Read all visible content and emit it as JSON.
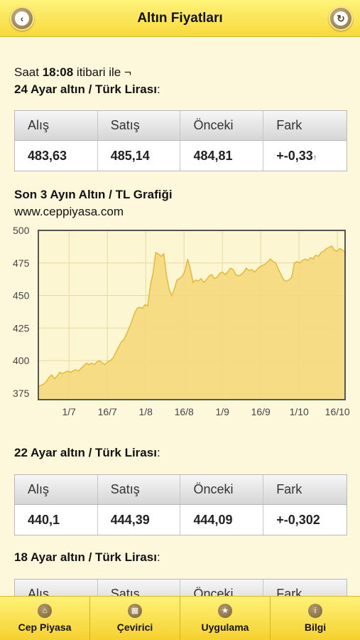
{
  "header": {
    "title": "Altın Fiyatları"
  },
  "intro": {
    "prefix": "Saat ",
    "time": "18:08",
    "suffix": " itibari ile ¬"
  },
  "sections": [
    {
      "heading_bold": "24 Ayar altın / Türk Lirası",
      "heading_rest": ":",
      "columns": [
        "Alış",
        "Satış",
        "Önceki",
        "Fark"
      ],
      "values": [
        "483,63",
        "485,14",
        "484,81",
        "+-0,33"
      ],
      "fark_arrow": "↑"
    },
    {
      "heading_bold": "22 Ayar altın / Türk Lirası",
      "heading_rest": ":",
      "columns": [
        "Alış",
        "Satış",
        "Önceki",
        "Fark"
      ],
      "values": [
        "440,1",
        "444,39",
        "444,09",
        "+-0,302"
      ]
    },
    {
      "heading_bold": "18 Ayar altın / Türk Lirası",
      "heading_rest": ":",
      "columns": [
        "Alış",
        "Satış",
        "Önceki",
        "Fark"
      ]
    }
  ],
  "chart_heading": {
    "title": "Son 3 Ayın Altın / TL Grafiği",
    "source": "www.ceppiyasa.com"
  },
  "chart_data": {
    "type": "area",
    "title": "Son 3 Ayın Altın / TL Grafiği",
    "xlabel": "",
    "ylabel": "",
    "ylim": [
      370,
      500
    ],
    "y_ticks": [
      "500",
      "475",
      "450",
      "425",
      "400",
      "375"
    ],
    "x_ticks": [
      "1/7",
      "16/7",
      "1/8",
      "16/8",
      "1/9",
      "16/9",
      "1/10",
      "16/10"
    ],
    "grid": true,
    "colors": {
      "fill": "#f5d878",
      "line": "#e2b93c",
      "grid": "#e8d9a0",
      "frame": "#555555"
    },
    "series": [
      {
        "values": [
          [
            0,
            380
          ],
          [
            2,
            382
          ],
          [
            3,
            384
          ],
          [
            4,
            387
          ],
          [
            5,
            389
          ],
          [
            6,
            386
          ],
          [
            7,
            388
          ],
          [
            8,
            391
          ],
          [
            9,
            390
          ],
          [
            10,
            391
          ],
          [
            11,
            392
          ],
          [
            12,
            391
          ],
          [
            13,
            392
          ],
          [
            14,
            393
          ],
          [
            15,
            392
          ],
          [
            16,
            394
          ],
          [
            17,
            396
          ],
          [
            18,
            398
          ],
          [
            19,
            397
          ],
          [
            20,
            398
          ],
          [
            21,
            397
          ],
          [
            22,
            399
          ],
          [
            23,
            400
          ],
          [
            24,
            398
          ],
          [
            25,
            397
          ],
          [
            26,
            399
          ],
          [
            27,
            400
          ],
          [
            28,
            402
          ],
          [
            29,
            406
          ],
          [
            30,
            410
          ],
          [
            31,
            414
          ],
          [
            32,
            416
          ],
          [
            33,
            420
          ],
          [
            34,
            425
          ],
          [
            35,
            430
          ],
          [
            36,
            436
          ],
          [
            37,
            440
          ],
          [
            38,
            441
          ],
          [
            39,
            440
          ],
          [
            40,
            443
          ],
          [
            41,
            442
          ],
          [
            42,
            458
          ],
          [
            43,
            467
          ],
          [
            44,
            483
          ],
          [
            45,
            482
          ],
          [
            46,
            480
          ],
          [
            47,
            482
          ],
          [
            48,
            466
          ],
          [
            49,
            455
          ],
          [
            50,
            450
          ],
          [
            51,
            455
          ],
          [
            52,
            462
          ],
          [
            53,
            463
          ],
          [
            54,
            465
          ],
          [
            55,
            469
          ],
          [
            56,
            478
          ],
          [
            57,
            470
          ],
          [
            58,
            460
          ],
          [
            59,
            462
          ],
          [
            60,
            461
          ],
          [
            61,
            463
          ],
          [
            62,
            460
          ],
          [
            63,
            462
          ],
          [
            64,
            465
          ],
          [
            65,
            466
          ],
          [
            66,
            463
          ],
          [
            67,
            464
          ],
          [
            68,
            467
          ],
          [
            69,
            468
          ],
          [
            70,
            466
          ],
          [
            71,
            468
          ],
          [
            72,
            471
          ],
          [
            73,
            470
          ],
          [
            74,
            466
          ],
          [
            75,
            465
          ],
          [
            76,
            466
          ],
          [
            77,
            468
          ],
          [
            78,
            471
          ],
          [
            79,
            469
          ],
          [
            80,
            470
          ],
          [
            81,
            468
          ],
          [
            82,
            470
          ],
          [
            83,
            472
          ],
          [
            84,
            473
          ],
          [
            85,
            474
          ],
          [
            86,
            476
          ],
          [
            87,
            478
          ],
          [
            88,
            476
          ],
          [
            89,
            475
          ],
          [
            90,
            470
          ],
          [
            91,
            466
          ],
          [
            92,
            462
          ],
          [
            93,
            461
          ],
          [
            94,
            462
          ],
          [
            95,
            464
          ],
          [
            96,
            475
          ],
          [
            97,
            476
          ],
          [
            98,
            475
          ],
          [
            99,
            477
          ],
          [
            100,
            478
          ],
          [
            101,
            477
          ],
          [
            102,
            479
          ],
          [
            103,
            478
          ],
          [
            104,
            481
          ],
          [
            105,
            480
          ],
          [
            106,
            483
          ],
          [
            107,
            484
          ],
          [
            108,
            486
          ],
          [
            109,
            487
          ],
          [
            110,
            488
          ],
          [
            111,
            485
          ],
          [
            112,
            484
          ],
          [
            113,
            486
          ],
          [
            114,
            485
          ],
          [
            115,
            483
          ]
        ]
      }
    ]
  },
  "tabbar": {
    "items": [
      {
        "label": "Cep Piyasa",
        "icon": "home-icon"
      },
      {
        "label": "Çevirici",
        "icon": "grid-icon"
      },
      {
        "label": "Uygulama",
        "icon": "star-icon"
      },
      {
        "label": "Bilgi",
        "icon": "info-icon"
      }
    ]
  }
}
